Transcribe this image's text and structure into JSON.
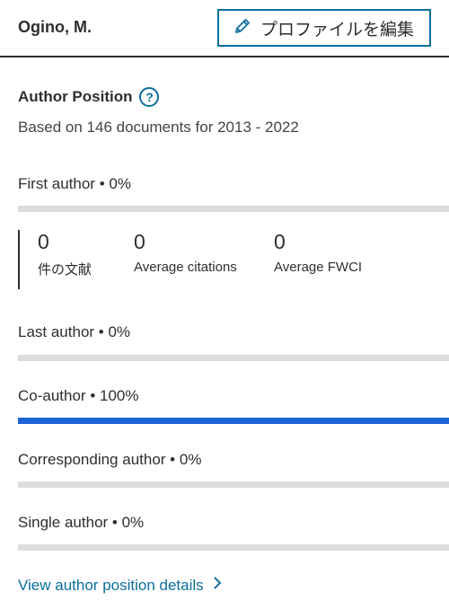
{
  "header": {
    "author_name": "Ogino, M.",
    "edit_button_label": "プロファイルを編集"
  },
  "section": {
    "title": "Author Position",
    "subtitle": "Based on 146 documents for 2013 - 2022"
  },
  "positions": [
    {
      "label": "First author",
      "value": "0%",
      "fraction": 0
    },
    {
      "label": "Last author",
      "value": "0%",
      "fraction": 0
    },
    {
      "label": "Co-author",
      "value": "100%",
      "fraction": 1.0
    },
    {
      "label": "Corresponding author",
      "value": "0%",
      "fraction": 0
    },
    {
      "label": "Single author",
      "value": "0%",
      "fraction": 0
    }
  ],
  "metrics": [
    {
      "value": "0",
      "label": "件の文献"
    },
    {
      "value": "0",
      "label": "Average citations"
    },
    {
      "value": "0",
      "label": "Average FWCI"
    }
  ],
  "link_label": "View author position details",
  "icons": {
    "edit": "pencil-icon",
    "help": "help-circle-icon",
    "chevron": "chevron-right-icon"
  },
  "colors": {
    "accent": "#0c6e9e",
    "bar_fill": "#1b64d4",
    "bar_track": "#dcdcdc"
  }
}
